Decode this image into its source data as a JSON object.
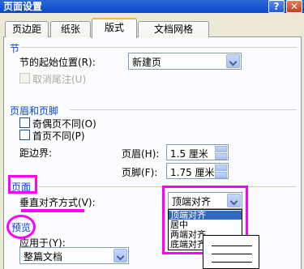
{
  "window": {
    "title": "页面设置",
    "help_glyph": "?",
    "close_glyph": "✕"
  },
  "tabs": [
    "页边距",
    "纸张",
    "版式",
    "文档网格"
  ],
  "section_section": {
    "title": "节",
    "start_label": "节的起始位置(R):",
    "start_value": "新建页",
    "suppress_endnotes_label": "取消尾注(U)"
  },
  "header_footer": {
    "title": "页眉和页脚",
    "odd_even_label": "奇偶页不同(O)",
    "first_page_label": "首页不同(P)",
    "from_edge_label": "距边界:",
    "header_label": "页眉(H):",
    "header_value": "1.5 厘米",
    "footer_label": "页脚(F):",
    "footer_value": "1.75 厘米"
  },
  "page": {
    "title": "页面",
    "vertical_align_label": "垂直对齐方式(V):",
    "vertical_align_value": "顶端对齐",
    "options": [
      "顶端对齐",
      "居中",
      "两端对齐",
      "底端对齐"
    ]
  },
  "preview": {
    "title": "预览",
    "apply_to_label": "应用于(Y):",
    "apply_to_value": "整篇文档"
  },
  "colors": {
    "highlight": "#ff00ff",
    "section_title": "#0046d5",
    "selection": "#316ac5"
  }
}
